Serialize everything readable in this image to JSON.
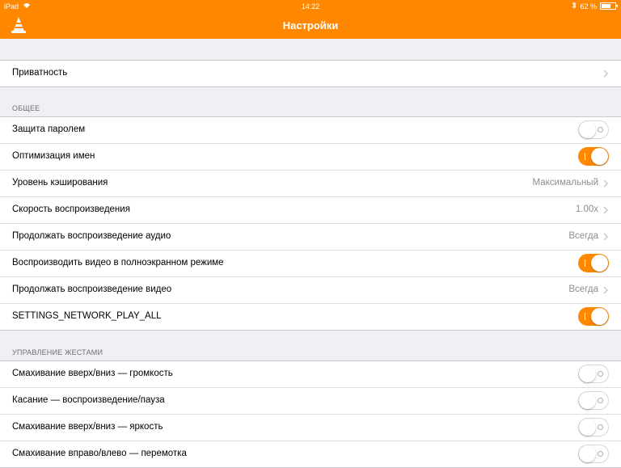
{
  "status_bar": {
    "carrier": "iPad",
    "time": "14:22",
    "battery_text": "62 %",
    "battery_level": 0.62
  },
  "nav": {
    "title": "Настройки",
    "logo": "vlc-cone-icon",
    "accent": "#ff8800"
  },
  "privacy": {
    "label": "Приватность"
  },
  "general": {
    "header": "ОБЩЕЕ",
    "rows": [
      {
        "label": "Защита паролем",
        "kind": "toggle",
        "on": false
      },
      {
        "label": "Оптимизация имен",
        "kind": "toggle",
        "on": true
      },
      {
        "label": "Уровень кэширования",
        "kind": "value",
        "value": "Максимальный"
      },
      {
        "label": "Скорость воспроизведения",
        "kind": "value",
        "value": "1.00x"
      },
      {
        "label": "Продолжать воспроизведение аудио",
        "kind": "value",
        "value": "Всегда"
      },
      {
        "label": "Воспроизводить видео в полноэкранном режиме",
        "kind": "toggle",
        "on": true
      },
      {
        "label": "Продолжать воспроизведение видео",
        "kind": "value",
        "value": "Всегда"
      },
      {
        "label": "SETTINGS_NETWORK_PLAY_ALL",
        "kind": "toggle",
        "on": true
      }
    ]
  },
  "gestures": {
    "header": "УПРАВЛЕНИЕ ЖЕСТАМИ",
    "rows": [
      {
        "label": "Смахивание вверх/вниз — громкость",
        "kind": "toggle",
        "on": false
      },
      {
        "label": "Касание — воспроизведение/пауза",
        "kind": "toggle",
        "on": false
      },
      {
        "label": "Смахивание вверх/вниз — яркость",
        "kind": "toggle",
        "on": false
      },
      {
        "label": "Смахивание вправо/влево — перемотка",
        "kind": "toggle",
        "on": false
      }
    ]
  }
}
